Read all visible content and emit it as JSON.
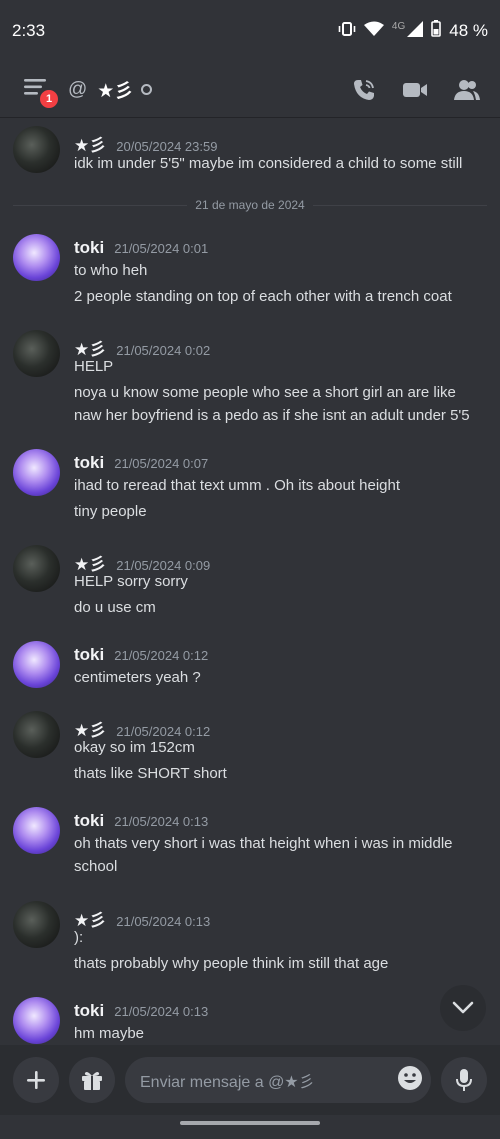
{
  "status_bar": {
    "time": "2:33",
    "network": "4G",
    "battery": "48 %"
  },
  "header": {
    "at_symbol": "@",
    "channel_name": "★彡",
    "notification_count": "1"
  },
  "composer": {
    "placeholder": "Enviar mensaje a @★彡"
  },
  "date_divider": "21 de mayo de 2024",
  "messages": [
    {
      "author": "★彡",
      "time": "20/05/2024 23:59",
      "lines": [
        "idk im under 5'5\" maybe im considered a child to some still"
      ]
    },
    {
      "author": "toki",
      "time": "21/05/2024 0:01",
      "lines": [
        "to who heh",
        "2 people standing on top of  each other with a trench coat"
      ]
    },
    {
      "author": "★彡",
      "time": "21/05/2024 0:02",
      "lines": [
        "HELP",
        "noya u know some people who see a short girl an are like",
        "naw her boyfriend is a pedo as if she isnt an adult under 5'5"
      ]
    },
    {
      "author": "toki",
      "time": "21/05/2024 0:07",
      "lines": [
        "ihad to reread that text umm . Oh its about height",
        "tiny people"
      ]
    },
    {
      "author": "★彡",
      "time": "21/05/2024 0:09",
      "lines": [
        "HELP sorry sorry",
        "do u use cm"
      ]
    },
    {
      "author": "toki",
      "time": "21/05/2024 0:12",
      "lines": [
        "centimeters yeah ?"
      ]
    },
    {
      "author": "★彡",
      "time": "21/05/2024 0:12",
      "lines": [
        "okay so im 152cm",
        "thats like SHORT short"
      ]
    },
    {
      "author": "toki",
      "time": "21/05/2024 0:13",
      "lines": [
        "oh thats very short i was that height when i was in middle",
        "school"
      ]
    },
    {
      "author": "★彡",
      "time": "21/05/2024 0:13",
      "lines": [
        "):",
        "thats probably why people think im still that age"
      ]
    },
    {
      "author": "toki",
      "time": "21/05/2024 0:13",
      "lines": [
        "hm maybe"
      ]
    }
  ]
}
